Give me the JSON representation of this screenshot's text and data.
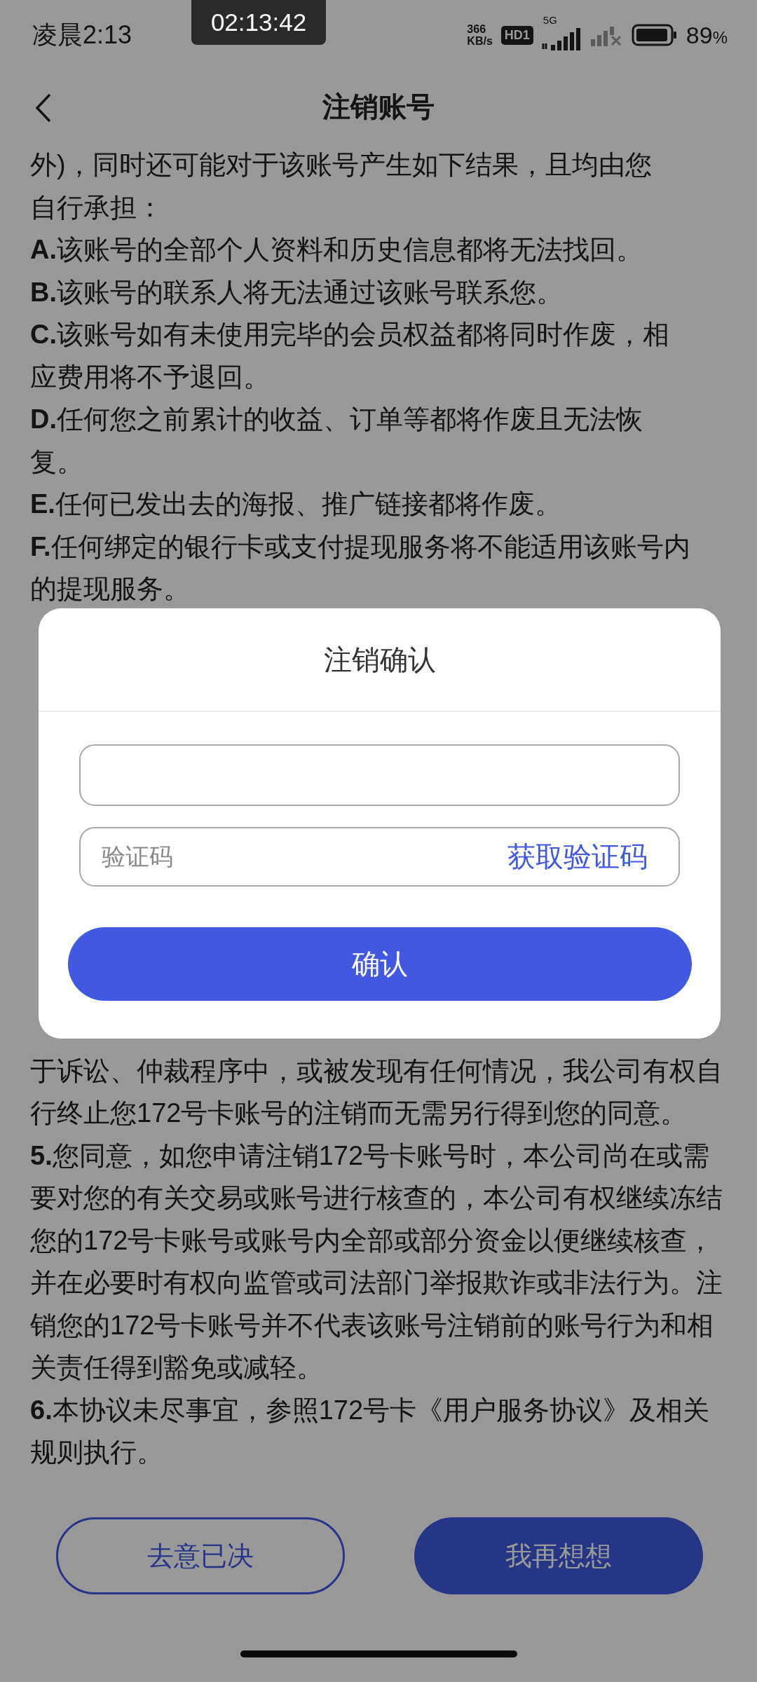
{
  "status_bar": {
    "time": "凌晨2:13",
    "recording_timer": "02:13:42",
    "net_speed_value": "366",
    "net_speed_unit": "KB/s",
    "hd_badge": "HD1",
    "network": "5G",
    "battery": "89",
    "battery_unit": "%"
  },
  "header": {
    "title": "注销账号"
  },
  "agreement_top": [
    {
      "text": "外)，同时还可能对于该账号产生如下结果，且均由您"
    },
    {
      "text": "自行承担："
    },
    {
      "text": "**A.**该账号的全部个人资料和历史信息都将无法找回。"
    },
    {
      "text": "**B.**该账号的联系人将无法通过该账号联系您。"
    },
    {
      "text": "**C.**该账号如有未使用完毕的会员权益都将同时作废，相应费用将不予退回。"
    },
    {
      "text": "**D.**任何您之前累计的收益、订单等都将作废且无法恢复。"
    },
    {
      "text": "**E.**任何已发出去的海报、推广链接都将作废。"
    },
    {
      "text": "**F.**任何绑定的银行卡或支付提现服务将不能适用该账号内的提现服务。"
    }
  ],
  "agreement_bottom": [
    {
      "text": "于诉讼、仲裁程序中，或被发现有任何情况，我公司有权自行终止您172号卡账号的注销而无需另行得到您的同意。"
    },
    {
      "text": "**5.**您同意，如您申请注销172号卡账号时，本公司尚在或需要对您的有关交易或账号进行核查的，本公司有权继续冻结您的172号卡账号或账号内全部或部分资金以便继续核查，并在必要时有权向监管或司法部门举报欺诈或非法行为。注销您的172号卡账号并不代表该账号注销前的账号行为和相关责任得到豁免或减轻。"
    },
    {
      "text": "**6.**本协议未尽事宜，参照172号卡《用户服务协议》及相关规则执行。"
    }
  ],
  "footer_buttons": [
    {
      "label": "去意已决",
      "kind": "outline"
    },
    {
      "label": "我再想想",
      "kind": "filled"
    }
  ],
  "dialog": {
    "title": "注销确认",
    "code_field": {
      "placeholder": "验证码"
    },
    "get_code_link": "获取验证码",
    "confirm_button": "确认"
  }
}
